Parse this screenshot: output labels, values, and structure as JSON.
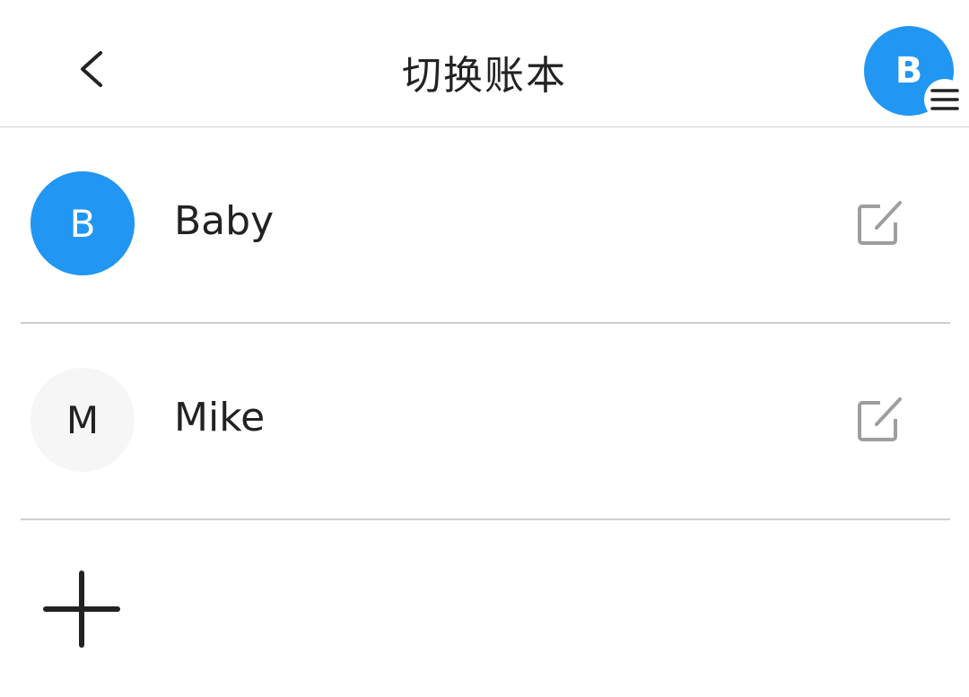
{
  "header": {
    "title": "切换账本",
    "back_icon": "chevron-left-icon",
    "current_account_initial": "B",
    "menu_icon": "menu-icon"
  },
  "accounts": [
    {
      "initial": "B",
      "name": "Baby",
      "avatar_color": "#2196f3",
      "active": true,
      "edit_icon": "edit-icon"
    },
    {
      "initial": "M",
      "name": "Mike",
      "avatar_color": "#f6f6f6",
      "active": false,
      "edit_icon": "edit-icon"
    }
  ],
  "add_icon": "plus-icon",
  "colors": {
    "accent": "#2196f3",
    "text": "#222222",
    "divider": "#cfcfcf",
    "icon_grey": "#9e9e9e"
  }
}
